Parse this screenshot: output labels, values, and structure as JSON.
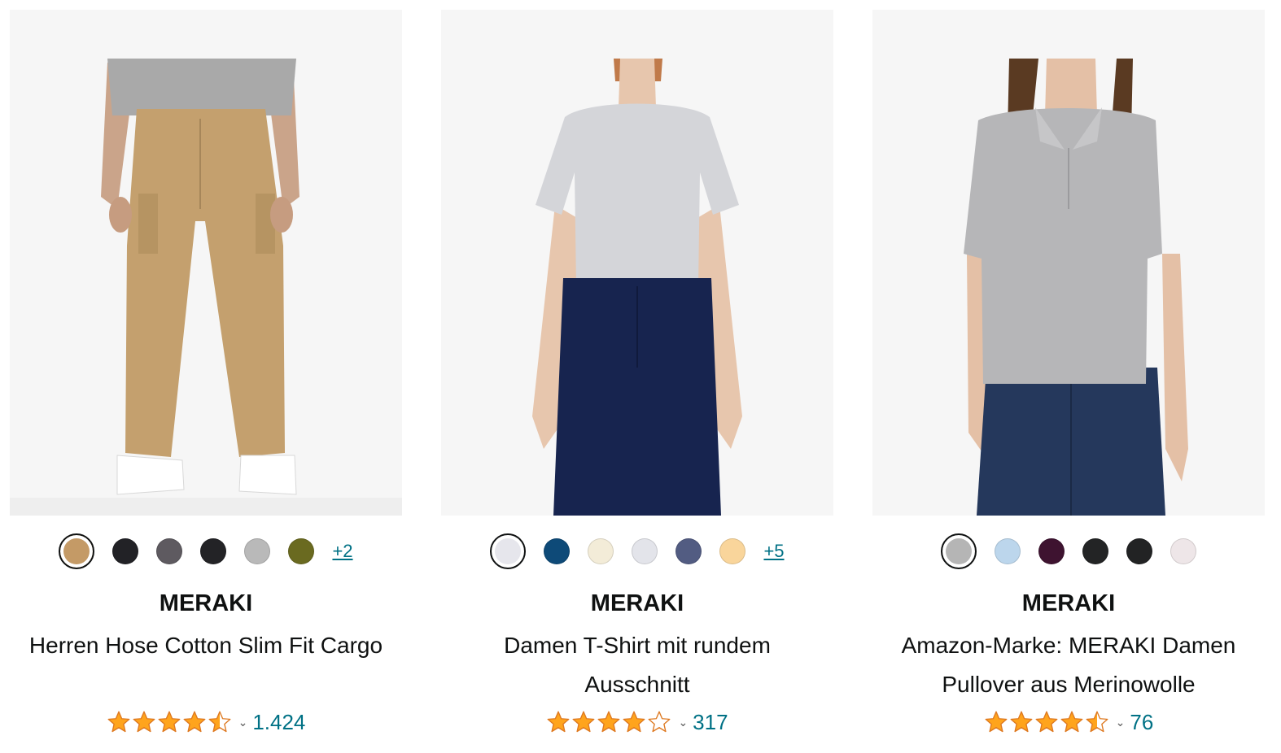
{
  "products": [
    {
      "brand": "MERAKI",
      "title": "Herren Hose Cotton Slim Fit Cargo",
      "rating": 4.5,
      "rating_count": "1.424",
      "more_colors_label": "+2",
      "swatch_colors": [
        "#c49a66",
        "#222226",
        "#5e5a60",
        "#232326",
        "#b9b9b9",
        "#6a6a20"
      ],
      "selected_swatch": 0
    },
    {
      "brand": "MERAKI",
      "title": "Damen T-Shirt mit rundem Ausschnitt",
      "rating": 4.0,
      "rating_count": "317",
      "more_colors_label": "+5",
      "swatch_colors": [
        "#e6e6ec",
        "#0e4a78",
        "#f3ecd8",
        "#e3e4ea",
        "#525c82",
        "#f9d59b"
      ],
      "selected_swatch": 0
    },
    {
      "brand": "MERAKI",
      "title": "Amazon-Marke: MERAKI Damen Pullover aus Merinowolle",
      "rating": 4.5,
      "rating_count": "76",
      "more_colors_label": "",
      "swatch_colors": [
        "#b5b5b5",
        "#bcd6ec",
        "#3e1330",
        "#232425",
        "#222324",
        "#eee6e8"
      ],
      "selected_swatch": 0
    }
  ],
  "colors": {
    "star": "#ffa41c",
    "link": "#007185",
    "text": "#0f1111",
    "image_bg": "#f6f6f6"
  },
  "icons": {
    "rating_popover": "chevron-down-icon",
    "star": "star-icon"
  }
}
